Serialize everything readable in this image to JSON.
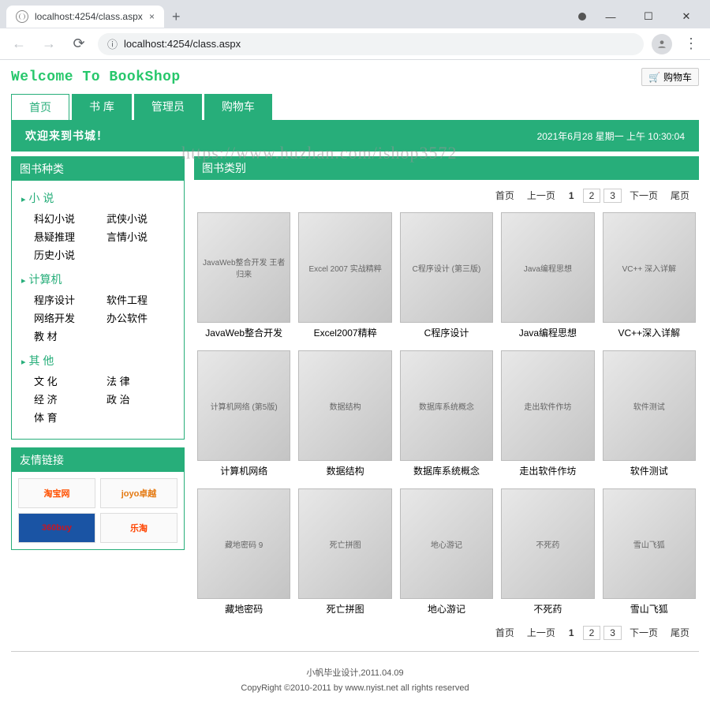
{
  "browser": {
    "tab_title": "localhost:4254/class.aspx",
    "url_display": "localhost:4254/class.aspx",
    "new_tab": "+",
    "close": "×",
    "min": "—",
    "max": "☐",
    "x": "✕",
    "info_icon": "ⓘ",
    "menu": "⋮"
  },
  "header": {
    "welcome": "Welcome To BookShop",
    "cart_icon": "🛒",
    "cart_label": "购物车",
    "watermark": "https://www.huzhan.com/ishop3572"
  },
  "nav": {
    "tabs": [
      "首页",
      "书 库",
      "管理员",
      "购物车"
    ]
  },
  "banner": {
    "welcome": "欢迎来到书城！",
    "datetime": "2021年6月28 星期一 上午 10:30:04"
  },
  "sidebar": {
    "category_title": "图书种类",
    "categories": [
      {
        "name": "小 说",
        "subs": [
          "科幻小说",
          "武侠小说",
          "悬疑推理",
          "言情小说",
          "历史小说"
        ]
      },
      {
        "name": "计算机",
        "subs": [
          "程序设计",
          "软件工程",
          "网络开发",
          "办公软件",
          "教 材"
        ]
      },
      {
        "name": "其 他",
        "subs": [
          "文 化",
          "法 律",
          "经 济",
          "政 治",
          "体 育"
        ]
      }
    ],
    "links_title": "友情链接",
    "links": [
      "淘宝网",
      "joyo卓越",
      "360buy",
      "乐淘"
    ]
  },
  "main": {
    "section_title": "图书类别",
    "pager": {
      "first": "首页",
      "prev": "上一页",
      "next": "下一页",
      "last": "尾页",
      "pages": [
        "1",
        "2",
        "3"
      ]
    },
    "books": [
      {
        "title": "JavaWeb整合开发",
        "cover_hint": "JavaWeb整合开发 王者归来"
      },
      {
        "title": "Excel2007精粹",
        "cover_hint": "Excel 2007 实战精粹"
      },
      {
        "title": "C程序设计",
        "cover_hint": "C程序设计 (第三版)"
      },
      {
        "title": "Java编程思想",
        "cover_hint": "Java编程思想"
      },
      {
        "title": "VC++深入详解",
        "cover_hint": "VC++ 深入详解"
      },
      {
        "title": "计算机网络",
        "cover_hint": "计算机网络 (第5版)"
      },
      {
        "title": "数据结构",
        "cover_hint": "数据结构"
      },
      {
        "title": "数据库系统概念",
        "cover_hint": "数据库系统概念"
      },
      {
        "title": "走出软件作坊",
        "cover_hint": "走出软件作坊"
      },
      {
        "title": "软件测试",
        "cover_hint": "软件测试"
      },
      {
        "title": "藏地密码",
        "cover_hint": "藏地密码 9"
      },
      {
        "title": "死亡拼图",
        "cover_hint": "死亡拼图"
      },
      {
        "title": "地心游记",
        "cover_hint": "地心游记"
      },
      {
        "title": "不死药",
        "cover_hint": "不死药"
      },
      {
        "title": "雪山飞狐",
        "cover_hint": "雪山飞狐"
      }
    ]
  },
  "footer": {
    "line1": "小帆毕业设计,2011.04.09",
    "line2": "CopyRight ©2010-2011 by www.nyist.net all rights reserved"
  }
}
